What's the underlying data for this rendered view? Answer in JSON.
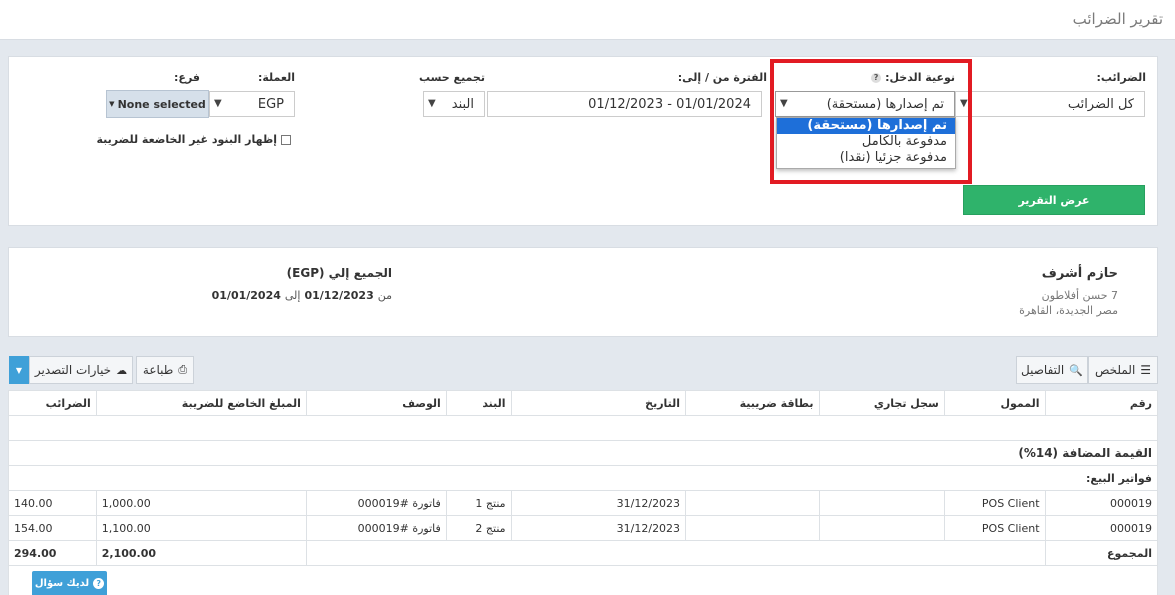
{
  "page": {
    "title": "تقرير الضرائب"
  },
  "filters": {
    "taxes_label": "الضرائب:",
    "taxes_value": "كل الضرائب",
    "income_type_label": "نوعية الدخل:",
    "income_type_help": "?",
    "income_type_value": "تم إصدارها (مستحقة)",
    "income_type_options": [
      "تم إصدارها (مستحقة)",
      "مدفوعة بالكامل",
      "مدفوعة جزئيا (نقدا)"
    ],
    "period_label": "الفترة من / إلى:",
    "period_value": "01/01/2024 - 01/12/2023",
    "group_by_label": "تجميع حسب",
    "group_by_value": "البند",
    "currency_label": "العملة:",
    "currency_value": "EGP",
    "branch_label": "فرع:",
    "branch_value": "None selected",
    "show_non_taxable_label": "إظهار البنود غير الخاضعة للضريبة",
    "view_report_button": "عرض التقرير"
  },
  "report_header": {
    "company_name": "حازم أشرف",
    "address_line1": "7 حسن أفلاطون",
    "address_line2": "مصر الجديدة، القاهرة",
    "currency_title": "الجميع إلي (EGP)",
    "date_from_word": "من",
    "date_from": "01/12/2023",
    "date_to_word": "إلى",
    "date_to": "01/01/2024"
  },
  "toolbar": {
    "summary": "الملخص",
    "details": "التفاصيل",
    "print": "طباعة",
    "export": "خيارات التصدير"
  },
  "table": {
    "headers": [
      "رقم",
      "الممول",
      "سجل تجاري",
      "بطاقة ضريبية",
      "التاريخ",
      "البند",
      "الوصف",
      "المبلغ الخاضع للضريبة",
      "الضرائب"
    ],
    "section_title": "القيمة المضافة (14%)",
    "subsection_title": "فواتير البيع:",
    "rows": [
      {
        "number": "000019",
        "client": "POS Client",
        "commercial_reg": "",
        "tax_card": "",
        "date": "31/12/2023",
        "item": "منتج 1",
        "description": "فاتورة #000019",
        "taxable_amount": "1,000.00",
        "tax": "140.00"
      },
      {
        "number": "000019",
        "client": "POS Client",
        "commercial_reg": "",
        "tax_card": "",
        "date": "31/12/2023",
        "item": "منتج 2",
        "description": "فاتورة #000019",
        "taxable_amount": "1,100.00",
        "tax": "154.00"
      }
    ],
    "total_label": "المجموع",
    "total_taxable": "2,100.00",
    "total_tax": "294.00"
  },
  "help_button": {
    "label": "لديك سؤال"
  },
  "colors": {
    "accent_green": "#2fb36b",
    "highlight_red": "#e21b23",
    "selected_blue": "#1e6fd9",
    "help_blue": "#3fa0d8"
  }
}
